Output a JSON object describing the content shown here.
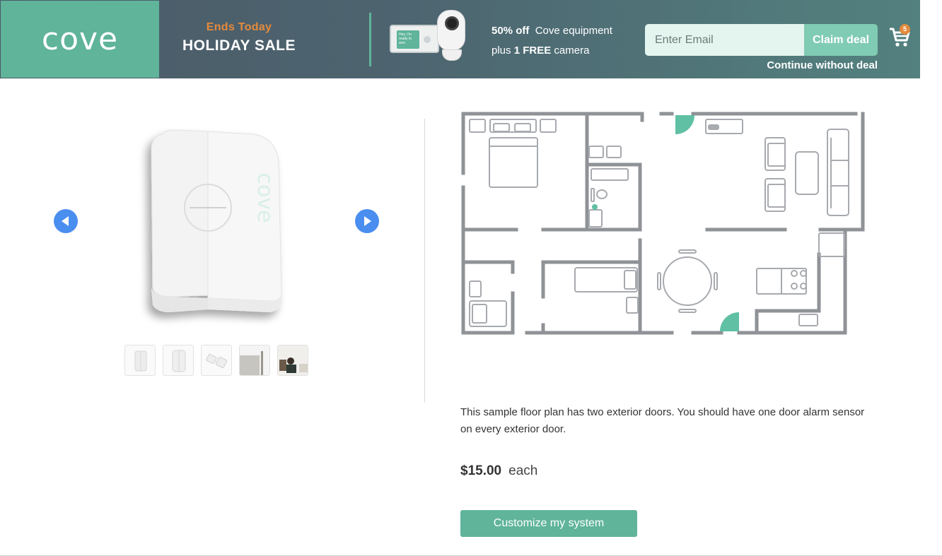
{
  "banner": {
    "logo": "cove",
    "ends_label": "Ends Today",
    "sale_title": "HOLIDAY SALE",
    "panel_screen_text": "Hey, I'm ready to arm.",
    "offer_line1_bold": "50% off",
    "offer_line1_rest": "Cove equipment",
    "offer_line2_prefix": "plus",
    "offer_line2_bold": "1 FREE",
    "offer_line2_rest": "camera",
    "email_placeholder": "Enter Email",
    "claim_label": "Claim deal",
    "continue_label": "Continue without deal",
    "cart_count": "5",
    "colors": {
      "brand": "#5fb49a",
      "accent": "#e58a3c",
      "arrow": "#4a8ef0"
    }
  },
  "gallery": {
    "product_brand_mark": "cove",
    "prev_icon": "arrow-left-icon",
    "next_icon": "arrow-right-icon",
    "thumbnails": [
      "sensor-front",
      "sensor-angle",
      "sensor-pair",
      "door-install",
      "person-room"
    ]
  },
  "details": {
    "description": "This sample floor plan has two exterior doors. You should have one door alarm sensor on every exterior door.",
    "price": "$15.00",
    "price_unit": "each",
    "cta_label": "Customize my system"
  }
}
